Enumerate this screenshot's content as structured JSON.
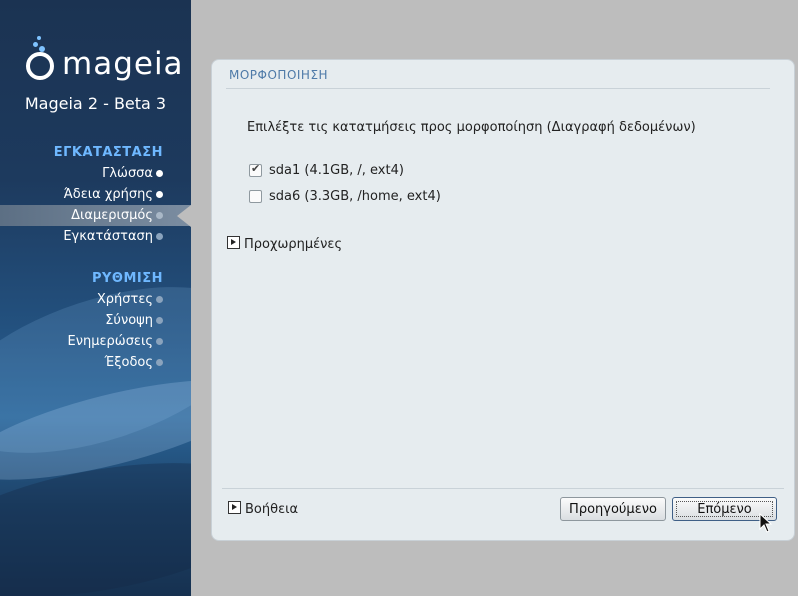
{
  "brand": {
    "logo_text": "mageia",
    "product": "Mageia 2 - Beta 3"
  },
  "sidebar": {
    "sections": [
      {
        "title": "ΕΓΚΑΤΑΣΤΑΣΗ",
        "items": [
          {
            "label": "Γλώσσα",
            "state": "done"
          },
          {
            "label": "Άδεια χρήσης",
            "state": "done"
          },
          {
            "label": "Διαμερισμός",
            "state": "active"
          },
          {
            "label": "Εγκατάσταση",
            "state": "pending"
          }
        ]
      },
      {
        "title": "ΡΥΘΜΙΣΗ",
        "items": [
          {
            "label": "Χρήστες",
            "state": "pending"
          },
          {
            "label": "Σύνοψη",
            "state": "pending"
          },
          {
            "label": "Ενημερώσεις",
            "state": "pending"
          },
          {
            "label": "Έξοδος",
            "state": "pending"
          }
        ]
      }
    ]
  },
  "panel": {
    "title": "ΜΟΡΦΟΠΟΙΗΣΗ",
    "prompt": "Επιλέξτε τις κατατμήσεις προς μορφοποίηση (Διαγραφή δεδομένων)",
    "partitions": [
      {
        "label": "sda1 (4.1GB, /, ext4)",
        "checked": true
      },
      {
        "label": "sda6 (3.3GB, /home, ext4)",
        "checked": false
      }
    ],
    "advanced_label": "Προχωρημένες",
    "help_label": "Βοήθεια",
    "prev_label": "Προηγούμενο",
    "next_label": "Επόμενο"
  },
  "colors": {
    "accent": "#4e7aa8",
    "section_title": "#6fb8ff",
    "panel_bg": "#e6ecef",
    "desktop_bg": "#bdbdbd"
  },
  "icons": {
    "checkmark": "check-icon",
    "expander": "triangle-right-icon",
    "cursor": "mouse-pointer-icon"
  }
}
